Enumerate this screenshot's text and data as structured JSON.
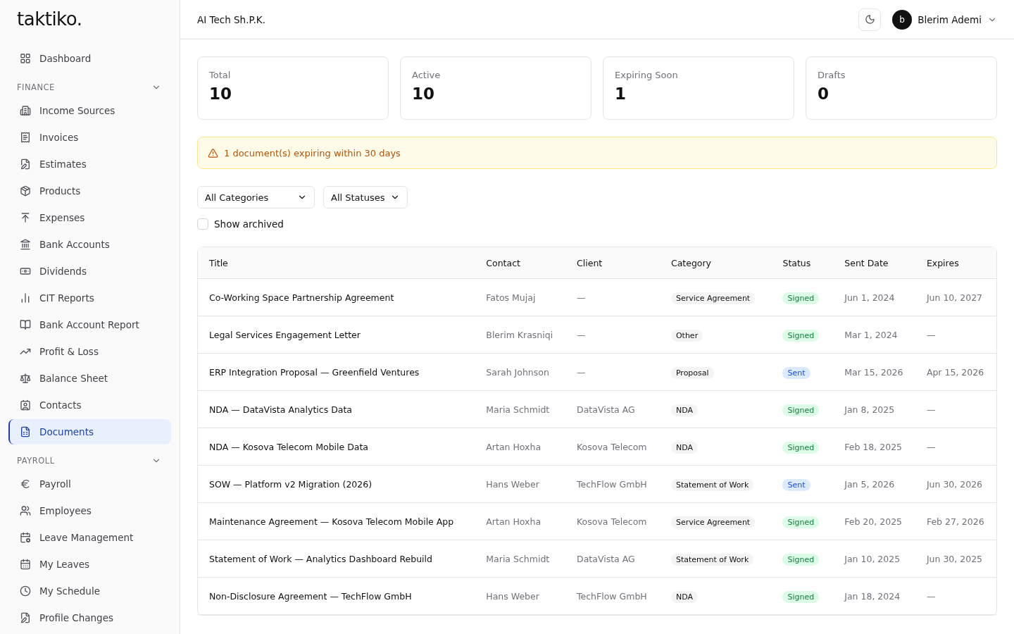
{
  "logo": "taktiko.",
  "sidebar": {
    "items": [
      {
        "kind": "link",
        "label": "Dashboard",
        "selected": false
      },
      {
        "kind": "section",
        "label": "FINANCE",
        "expanded": true
      },
      {
        "kind": "link",
        "label": "Income Sources",
        "selected": false
      },
      {
        "kind": "link",
        "label": "Invoices",
        "selected": false
      },
      {
        "kind": "link",
        "label": "Estimates",
        "selected": false
      },
      {
        "kind": "link",
        "label": "Products",
        "selected": false
      },
      {
        "kind": "link",
        "label": "Expenses",
        "selected": false
      },
      {
        "kind": "link",
        "label": "Bank Accounts",
        "selected": false
      },
      {
        "kind": "link",
        "label": "Dividends",
        "selected": false
      },
      {
        "kind": "link",
        "label": "CIT Reports",
        "selected": false
      },
      {
        "kind": "link",
        "label": "Bank Account Report",
        "selected": false
      },
      {
        "kind": "link",
        "label": "Profit & Loss",
        "selected": false
      },
      {
        "kind": "link",
        "label": "Balance Sheet",
        "selected": false
      },
      {
        "kind": "link",
        "label": "Contacts",
        "selected": false
      },
      {
        "kind": "link",
        "label": "Documents",
        "selected": true
      },
      {
        "kind": "section",
        "label": "PAYROLL",
        "expanded": true
      },
      {
        "kind": "link",
        "label": "Payroll",
        "selected": false
      },
      {
        "kind": "link",
        "label": "Employees",
        "selected": false
      },
      {
        "kind": "link",
        "label": "Leave Management",
        "selected": false
      },
      {
        "kind": "link",
        "label": "My Leaves",
        "selected": false
      },
      {
        "kind": "link",
        "label": "My Schedule",
        "selected": false
      },
      {
        "kind": "link",
        "label": "Profile Changes",
        "selected": false
      }
    ]
  },
  "header": {
    "company": "AI Tech Sh.P.K.",
    "user": {
      "initial": "b",
      "name": "Blerim Ademi"
    }
  },
  "stats": [
    {
      "label": "Total",
      "value": "10"
    },
    {
      "label": "Active",
      "value": "10"
    },
    {
      "label": "Expiring Soon",
      "value": "1"
    },
    {
      "label": "Drafts",
      "value": "0"
    }
  ],
  "alert": "1 document(s) expiring within 30 days",
  "filters": {
    "category": "All Categories",
    "status": "All Statuses",
    "show_archived": {
      "label": "Show archived",
      "checked": false
    }
  },
  "table": {
    "columns": [
      "Title",
      "Contact",
      "Client",
      "Category",
      "Status",
      "Sent Date",
      "Expires"
    ],
    "rows": [
      {
        "title": "Co-Working Space Partnership Agreement",
        "contact": "Fatos Mujaj",
        "client": "—",
        "category": "Service Agreement",
        "status": "Signed",
        "kind": "signed",
        "sent": "Jun 1, 2024",
        "expires": "Jun 10, 2027"
      },
      {
        "title": "Legal Services Engagement Letter",
        "contact": "Blerim Krasniqi",
        "client": "—",
        "category": "Other",
        "status": "Signed",
        "kind": "signed",
        "sent": "Mar 1, 2024",
        "expires": "—"
      },
      {
        "title": "ERP Integration Proposal — Greenfield Ventures",
        "contact": "Sarah Johnson",
        "client": "—",
        "category": "Proposal",
        "status": "Sent",
        "kind": "sent",
        "sent": "Mar 15, 2026",
        "expires": "Apr 15, 2026"
      },
      {
        "title": "NDA — DataVista Analytics Data",
        "contact": "Maria Schmidt",
        "client": "DataVista AG",
        "category": "NDA",
        "status": "Signed",
        "kind": "signed",
        "sent": "Jan 8, 2025",
        "expires": "—"
      },
      {
        "title": "NDA — Kosova Telecom Mobile Data",
        "contact": "Artan Hoxha",
        "client": "Kosova Telecom",
        "category": "NDA",
        "status": "Signed",
        "kind": "signed",
        "sent": "Feb 18, 2025",
        "expires": "—"
      },
      {
        "title": "SOW — Platform v2 Migration (2026)",
        "contact": "Hans Weber",
        "client": "TechFlow GmbH",
        "category": "Statement of Work",
        "status": "Sent",
        "kind": "sent",
        "sent": "Jan 5, 2026",
        "expires": "Jun 30, 2026"
      },
      {
        "title": "Maintenance Agreement — Kosova Telecom Mobile App",
        "contact": "Artan Hoxha",
        "client": "Kosova Telecom",
        "category": "Service Agreement",
        "status": "Signed",
        "kind": "signed",
        "sent": "Feb 20, 2025",
        "expires": "Feb 27, 2026"
      },
      {
        "title": "Statement of Work — Analytics Dashboard Rebuild",
        "contact": "Maria Schmidt",
        "client": "DataVista AG",
        "category": "Statement of Work",
        "status": "Signed",
        "kind": "signed",
        "sent": "Jan 10, 2025",
        "expires": "Jun 30, 2025"
      },
      {
        "title": "Non-Disclosure Agreement — TechFlow GmbH",
        "contact": "Hans Weber",
        "client": "TechFlow GmbH",
        "category": "NDA",
        "status": "Signed",
        "kind": "signed",
        "sent": "Jan 18, 2024",
        "expires": "—"
      }
    ]
  }
}
